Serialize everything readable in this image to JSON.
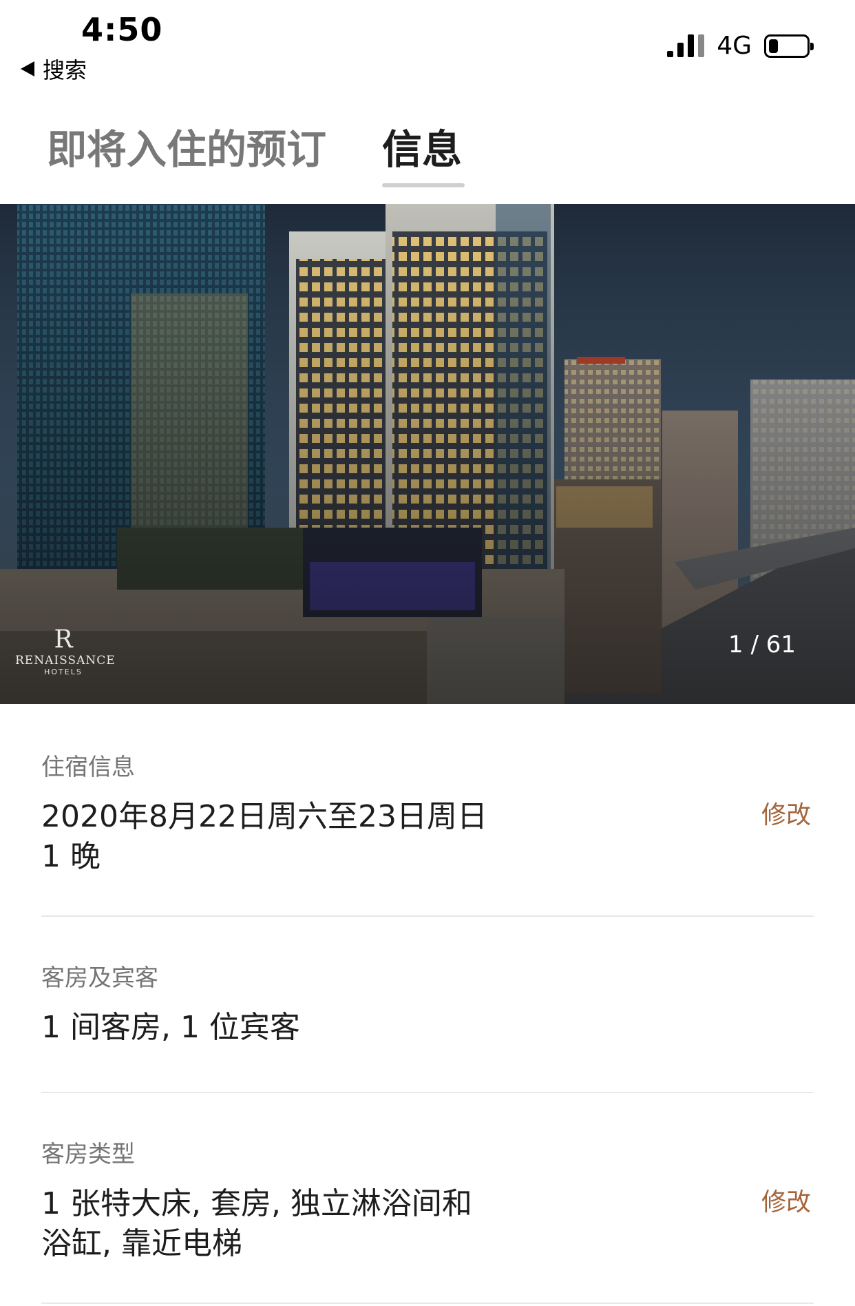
{
  "status_bar": {
    "time": "4:50",
    "back_label": "搜索",
    "network": "4G",
    "battery_level": 0.25
  },
  "tabs": [
    {
      "label": "即将入住的预订",
      "active": false
    },
    {
      "label": "信息",
      "active": true
    }
  ],
  "hero": {
    "brand_initial": "R",
    "brand_name": "RENAISSANCE",
    "brand_sub": "HOTELS",
    "photo_counter": "1 / 61"
  },
  "stay": {
    "label": "住宿信息",
    "dates": "2020年8月22日周六至23日周日",
    "nights": "1 晚",
    "edit_label": "修改"
  },
  "rooms_guests": {
    "label": "客房及宾客",
    "value": "1 间客房, 1 位宾客"
  },
  "room_type": {
    "label": "客房类型",
    "line1": "1 张特大床, 套房, 独立淋浴间和",
    "line2": "浴缸, 靠近电梯",
    "edit_label": "修改"
  },
  "colors": {
    "accent": "#a5643a",
    "label_gray": "#757575",
    "divider": "#e8e8e8"
  }
}
